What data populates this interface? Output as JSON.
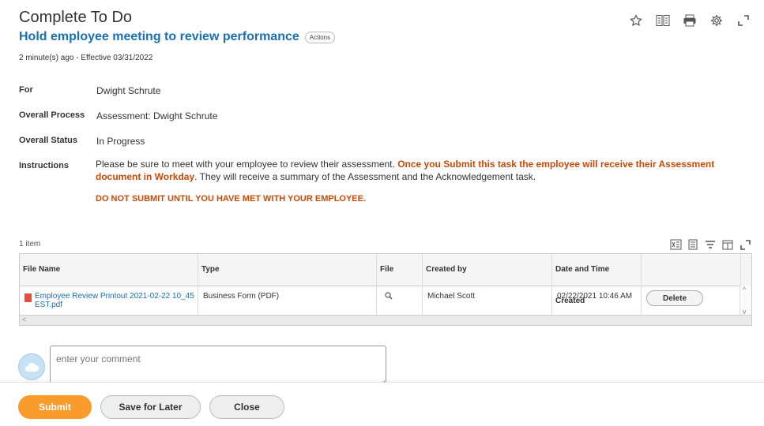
{
  "header": {
    "page_title": "Complete To Do",
    "task_title": "Hold employee meeting to review performance",
    "actions_label": "Actions",
    "meta": "2 minute(s) ago - Effective 03/31/2022"
  },
  "top_icons": [
    "star-icon",
    "compare-icon",
    "print-icon",
    "gear-icon",
    "expand-icon"
  ],
  "fields": {
    "for_label": "For",
    "for_value": "Dwight Schrute",
    "process_label": "Overall Process",
    "process_value": "Assessment: Dwight Schrute",
    "status_label": "Overall Status",
    "status_value": "In Progress",
    "instructions_label": "Instructions"
  },
  "instructions": {
    "part1": "Please be sure to meet with your employee to review their assessment. ",
    "part2_bold": "Once you Submit this task the employee will receive their Assessment document in Workday",
    "part3": ". They will receive a summary of the Assessment and the Acknowledgement task.",
    "warning": "DO NOT SUBMIT UNTIL YOU HAVE MET WITH YOUR EMPLOYEE."
  },
  "table": {
    "item_count": "1 item",
    "columns": [
      "File Name",
      "Type",
      "File",
      "Created by",
      "Date and Time Created"
    ],
    "rows": [
      {
        "file_name": "Employee Review Printout 2021-02-22 10_45 EST.pdf",
        "type": "Business Form (PDF)",
        "created_by": "Michael Scott",
        "date_created": "02/22/2021 10:46 AM",
        "action": "Delete"
      }
    ]
  },
  "comment": {
    "placeholder": "enter your comment"
  },
  "footer": {
    "submit": "Submit",
    "save_for_later": "Save for Later",
    "close": "Close"
  },
  "colors": {
    "link": "#1a6fb5",
    "accent_orange": "#f99c2b",
    "warning_text": "#c94a08"
  }
}
